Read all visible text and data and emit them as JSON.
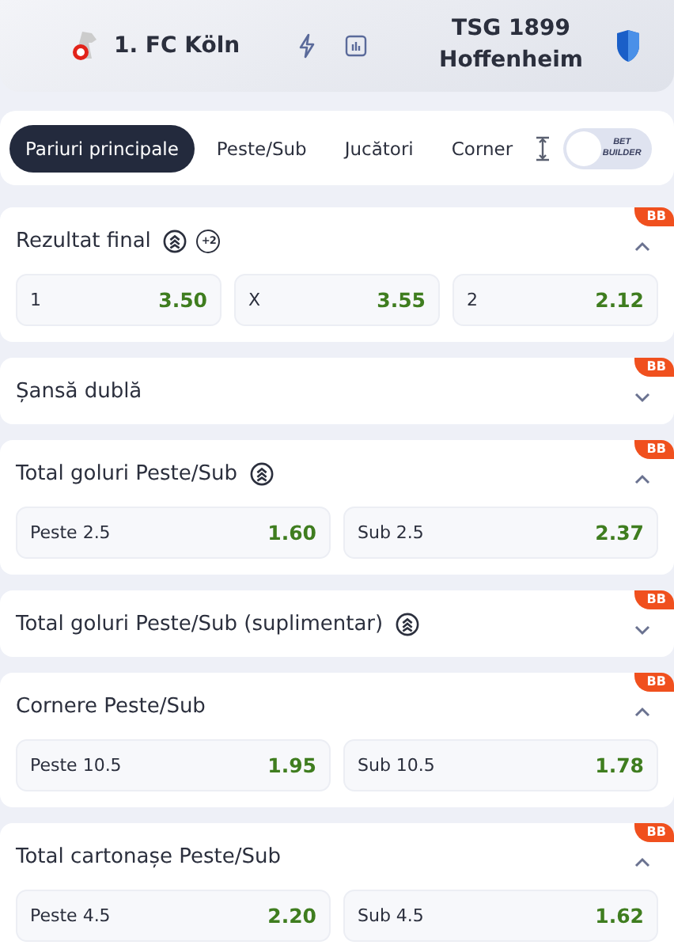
{
  "match": {
    "home": "1. FC Köln",
    "away": "TSG 1899 Hoffenheim"
  },
  "tabs": [
    {
      "label": "Pariuri principale",
      "selected": true
    },
    {
      "label": "Peste/Sub",
      "selected": false
    },
    {
      "label": "Jucători",
      "selected": false
    },
    {
      "label": "Corner",
      "selected": false
    }
  ],
  "bet_builder": {
    "label": "BET BUILDER",
    "on": false
  },
  "markets": [
    {
      "title": "Rezultat final",
      "badge": "BB",
      "expanded": true,
      "icons": [
        {
          "kind": "stack"
        },
        {
          "kind": "extra",
          "text": "+2"
        }
      ],
      "odds": [
        {
          "label": "1",
          "value": "3.50"
        },
        {
          "label": "X",
          "value": "3.55"
        },
        {
          "label": "2",
          "value": "2.12"
        }
      ]
    },
    {
      "title": "Șansă dublă",
      "badge": "BB",
      "expanded": false
    },
    {
      "title": "Total goluri Peste/Sub",
      "badge": "BB",
      "expanded": true,
      "icons": [
        {
          "kind": "stack"
        }
      ],
      "odds": [
        {
          "label": "Peste 2.5",
          "value": "1.60"
        },
        {
          "label": "Sub 2.5",
          "value": "2.37"
        }
      ]
    },
    {
      "title": "Total goluri Peste/Sub (suplimentar)",
      "badge": "BB",
      "expanded": false,
      "icons": [
        {
          "kind": "stack"
        }
      ]
    },
    {
      "title": "Cornere Peste/Sub",
      "badge": "BB",
      "expanded": true,
      "odds": [
        {
          "label": "Peste 10.5",
          "value": "1.95"
        },
        {
          "label": "Sub 10.5",
          "value": "1.78"
        }
      ]
    },
    {
      "title": "Total cartonașe Peste/Sub",
      "badge": "BB",
      "expanded": true,
      "odds": [
        {
          "label": "Peste 4.5",
          "value": "2.20"
        },
        {
          "label": "Sub 4.5",
          "value": "1.62"
        }
      ]
    }
  ]
}
